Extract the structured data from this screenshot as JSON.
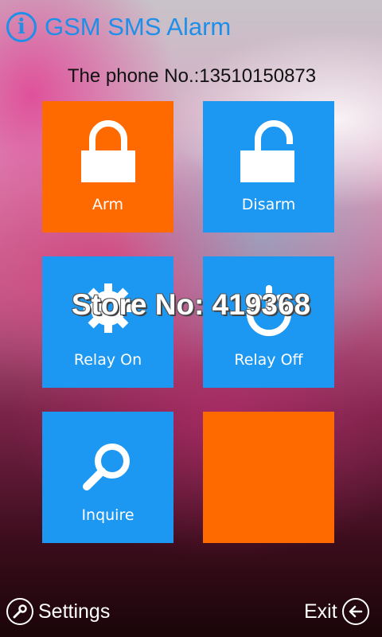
{
  "app": {
    "title": "GSM SMS Alarm",
    "info_icon": "info-icon"
  },
  "phone": {
    "label": "The phone No.:13510150873"
  },
  "tiles": [
    {
      "label": "Arm",
      "icon": "lock-icon",
      "color": "#ff6a00"
    },
    {
      "label": "Disarm",
      "icon": "unlock-icon",
      "color": "#1c97f2"
    },
    {
      "label": "Relay On",
      "icon": "gear-icon",
      "color": "#1c97f2"
    },
    {
      "label": "Relay Off",
      "icon": "power-icon",
      "color": "#1c97f2"
    },
    {
      "label": "Inquire",
      "icon": "search-icon",
      "color": "#1c97f2"
    },
    {
      "label": "",
      "icon": "",
      "color": "#ff6a00"
    }
  ],
  "watermark": "Store No: 419368",
  "bottom": {
    "settings_label": "Settings",
    "settings_icon": "wrench-icon",
    "exit_label": "Exit",
    "exit_icon": "back-arrow-icon"
  },
  "colors": {
    "accent": "#1e8fe8",
    "tile_orange": "#ff6a00",
    "tile_blue": "#1c97f2"
  }
}
